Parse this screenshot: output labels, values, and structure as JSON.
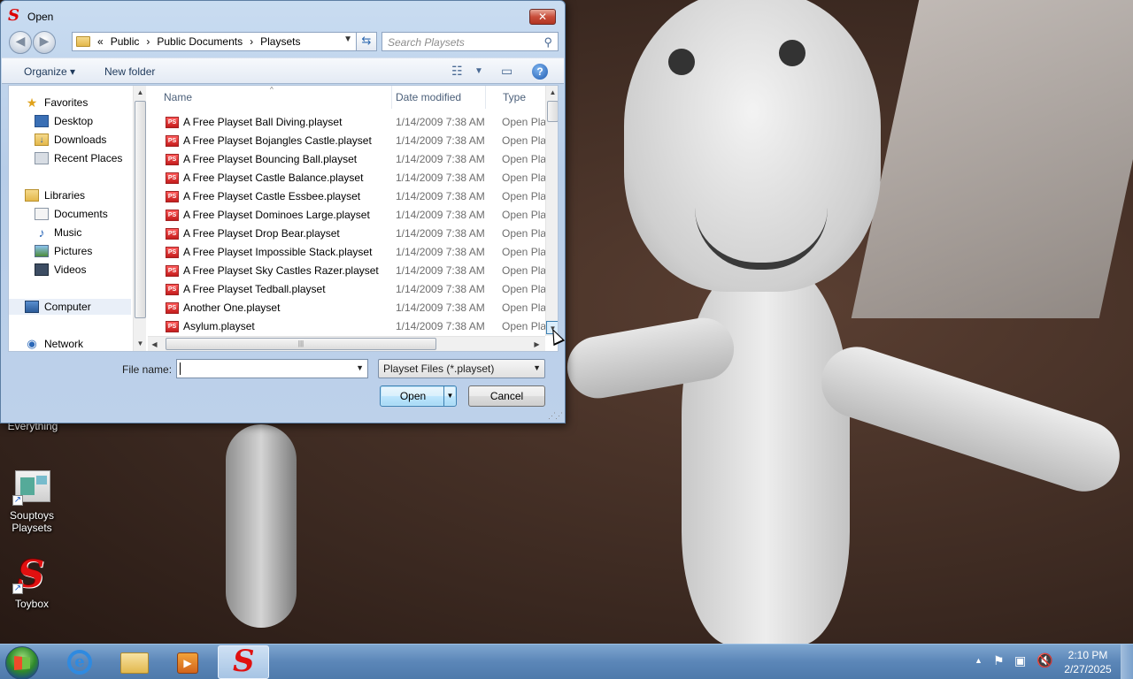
{
  "window": {
    "title": "Open"
  },
  "address": {
    "overflow": "«",
    "crumbs": [
      "Public",
      "Public Documents",
      "Playsets"
    ],
    "separator": "›",
    "search_placeholder": "Search Playsets"
  },
  "toolbar": {
    "organize": "Organize ▾",
    "new_folder": "New folder",
    "help": "?"
  },
  "nav": {
    "favorites": "Favorites",
    "desktop": "Desktop",
    "downloads": "Downloads",
    "recent": "Recent Places",
    "libraries": "Libraries",
    "documents": "Documents",
    "music": "Music",
    "pictures": "Pictures",
    "videos": "Videos",
    "computer": "Computer",
    "network": "Network"
  },
  "columns": {
    "name": "Name",
    "date": "Date modified",
    "type": "Type"
  },
  "files": [
    {
      "name": "A Free Playset Ball Diving.playset",
      "date": "1/14/2009 7:38 AM",
      "type": "Open Pla"
    },
    {
      "name": "A Free Playset Bojangles Castle.playset",
      "date": "1/14/2009 7:38 AM",
      "type": "Open Pla"
    },
    {
      "name": "A Free Playset Bouncing Ball.playset",
      "date": "1/14/2009 7:38 AM",
      "type": "Open Pla"
    },
    {
      "name": "A Free Playset Castle Balance.playset",
      "date": "1/14/2009 7:38 AM",
      "type": "Open Pla"
    },
    {
      "name": "A Free Playset Castle Essbee.playset",
      "date": "1/14/2009 7:38 AM",
      "type": "Open Pla"
    },
    {
      "name": "A Free Playset Dominoes Large.playset",
      "date": "1/14/2009 7:38 AM",
      "type": "Open Pla"
    },
    {
      "name": "A Free Playset Drop Bear.playset",
      "date": "1/14/2009 7:38 AM",
      "type": "Open Pla"
    },
    {
      "name": "A Free Playset Impossible Stack.playset",
      "date": "1/14/2009 7:38 AM",
      "type": "Open Pla"
    },
    {
      "name": "A Free Playset Sky Castles Razer.playset",
      "date": "1/14/2009 7:38 AM",
      "type": "Open Pla"
    },
    {
      "name": "A Free Playset Tedball.playset",
      "date": "1/14/2009 7:38 AM",
      "type": "Open Pla"
    },
    {
      "name": "Another One.playset",
      "date": "1/14/2009 7:38 AM",
      "type": "Open Pla"
    },
    {
      "name": "Asylum.playset",
      "date": "1/14/2009 7:38 AM",
      "type": "Open Pla"
    }
  ],
  "bottom": {
    "file_name_label": "File name:",
    "file_name_value": "",
    "filter": "Playset Files (*.playset)",
    "open": "Open",
    "cancel": "Cancel"
  },
  "desktop_icons": [
    {
      "label": "Everything"
    },
    {
      "label": "Souptoys Playsets"
    },
    {
      "label": "Toybox"
    }
  ],
  "clock": {
    "time": "2:10 PM",
    "date": "2/27/2025"
  },
  "colors": {
    "accent": "#3c7fb1",
    "taskbar": "#5b86b8",
    "playset_icon": "#c41c1c"
  }
}
